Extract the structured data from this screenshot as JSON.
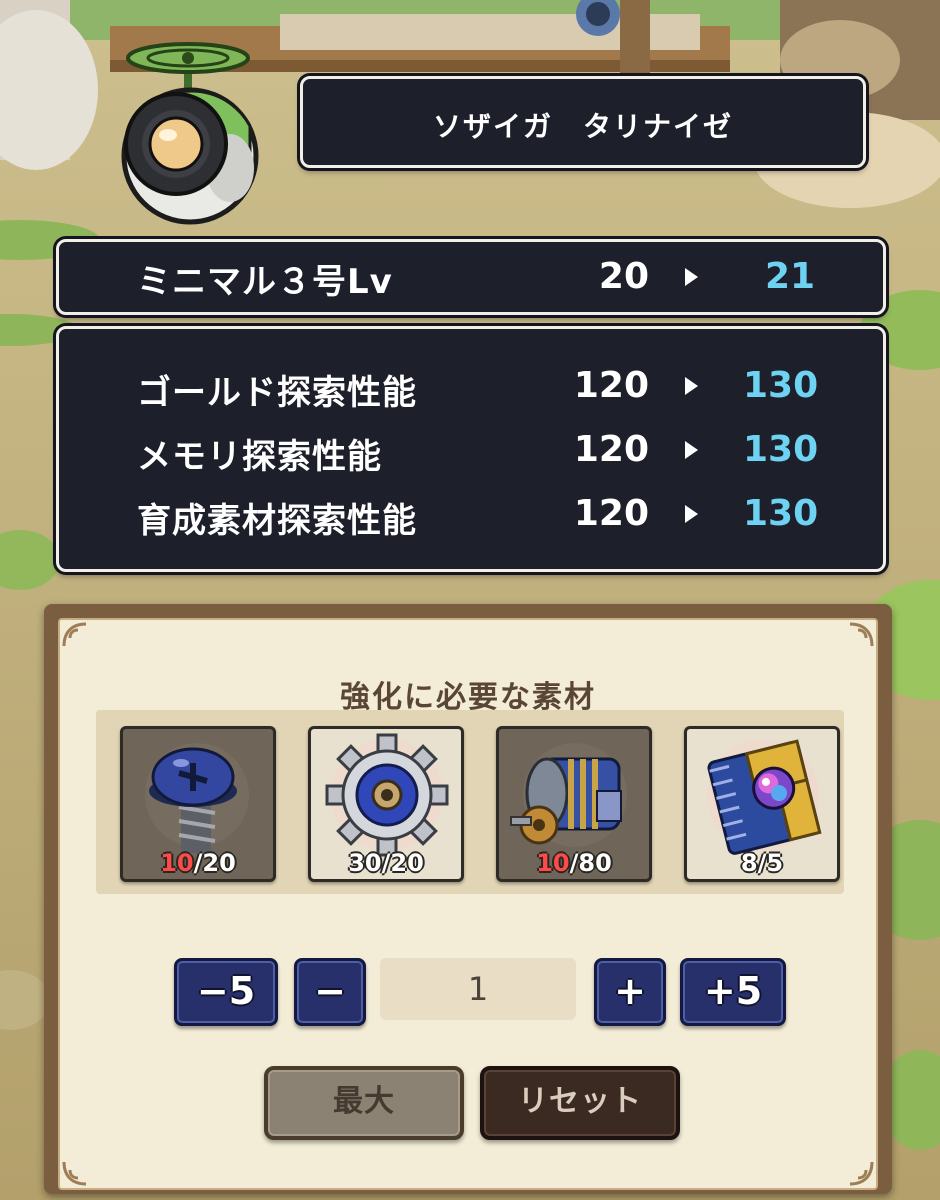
{
  "robot": {
    "name": "ソザイガ　タリナイゼ"
  },
  "level": {
    "label": "ミニマル３号Lv",
    "current": "20",
    "next": "21"
  },
  "stats": [
    {
      "label": "ゴールド探索性能",
      "current": "120",
      "next": "130"
    },
    {
      "label": "メモリ探索性能",
      "current": "120",
      "next": "130"
    },
    {
      "label": "育成素材探索性能",
      "current": "120",
      "next": "130"
    }
  ],
  "materials": {
    "title": "強化に必要な素材",
    "items": [
      {
        "icon": "screw-icon",
        "have": "10",
        "need": "20",
        "sufficient": false
      },
      {
        "icon": "gear-icon",
        "have": "30",
        "need": "20",
        "sufficient": true
      },
      {
        "icon": "motor-icon",
        "have": "10",
        "need": "80",
        "sufficient": false
      },
      {
        "icon": "memory-chip-book-icon",
        "have": "8",
        "need": "5",
        "sufficient": true
      }
    ]
  },
  "stepper": {
    "minus5_label": "−5",
    "minus_label": "−",
    "quantity": "1",
    "plus_label": "+",
    "plus5_label": "+5"
  },
  "buttons": {
    "max_label": "最大",
    "reset_label": "リセット"
  },
  "colors": {
    "panel_dark": "#1d1f2b",
    "new_value": "#6ed3f2",
    "insufficient": "#ff4a4a",
    "button_blue": "#27306b"
  }
}
